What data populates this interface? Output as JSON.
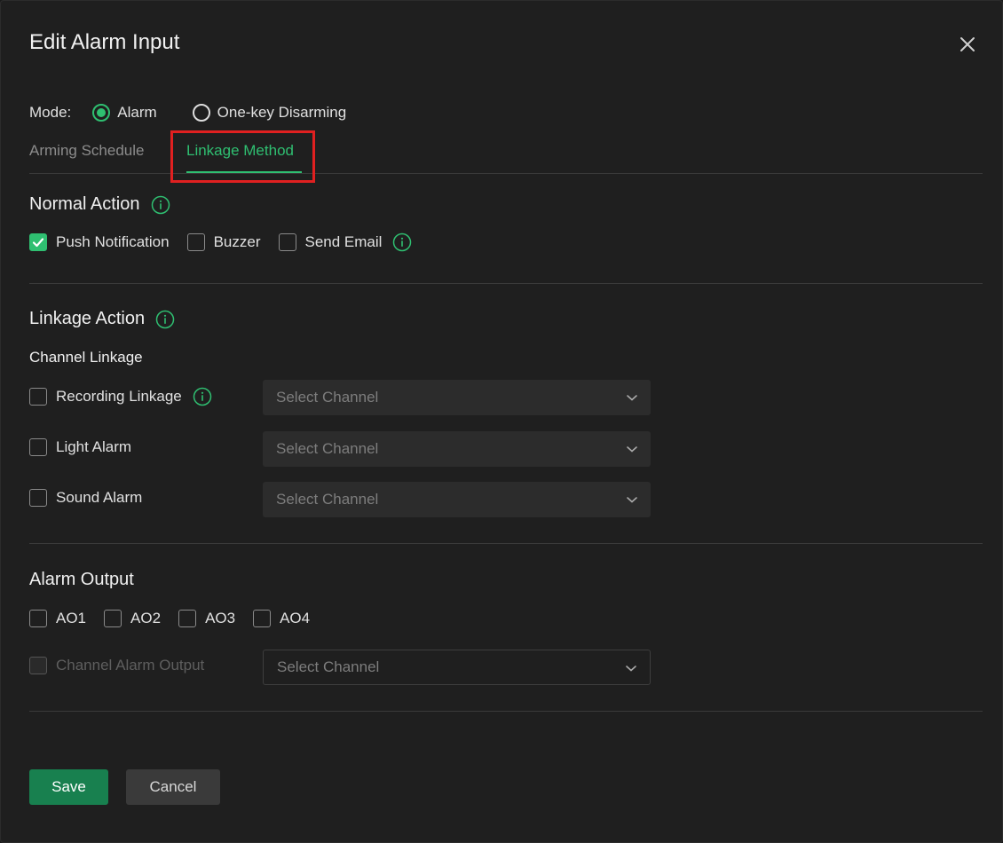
{
  "dialog": {
    "title": "Edit Alarm Input",
    "close_icon": "close-icon"
  },
  "mode": {
    "label": "Mode:",
    "options": [
      {
        "label": "Alarm",
        "selected": true
      },
      {
        "label": "One-key Disarming",
        "selected": false
      }
    ]
  },
  "tabs": [
    {
      "label": "Arming Schedule",
      "active": false
    },
    {
      "label": "Linkage Method",
      "active": true
    }
  ],
  "normal_action": {
    "title": "Normal Action",
    "items": [
      {
        "label": "Push Notification",
        "checked": true
      },
      {
        "label": "Buzzer",
        "checked": false
      },
      {
        "label": "Send Email",
        "checked": false
      }
    ]
  },
  "linkage_action": {
    "title": "Linkage Action",
    "subtitle": "Channel Linkage",
    "rows": [
      {
        "label": "Recording Linkage",
        "checked": false,
        "select_placeholder": "Select Channel"
      },
      {
        "label": "Light Alarm",
        "checked": false,
        "select_placeholder": "Select Channel"
      },
      {
        "label": "Sound Alarm",
        "checked": false,
        "select_placeholder": "Select Channel"
      }
    ]
  },
  "alarm_output": {
    "title": "Alarm Output",
    "outputs": [
      {
        "label": "AO1",
        "checked": false
      },
      {
        "label": "AO2",
        "checked": false
      },
      {
        "label": "AO3",
        "checked": false
      },
      {
        "label": "AO4",
        "checked": false
      }
    ],
    "channel_output": {
      "label": "Channel Alarm Output",
      "disabled": true,
      "select_placeholder": "Select Channel"
    }
  },
  "buttons": {
    "save": "Save",
    "cancel": "Cancel"
  },
  "colors": {
    "accent": "#2fbf71",
    "save_button": "#18804f",
    "highlight_box": "#e02020"
  }
}
